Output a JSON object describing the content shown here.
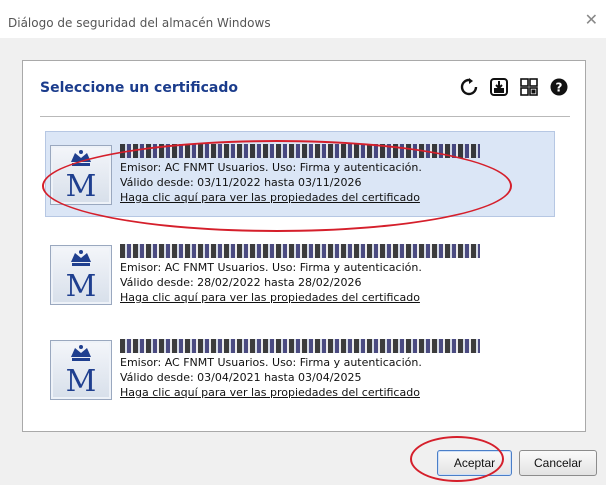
{
  "window": {
    "title": "Diálogo de seguridad del almacén Windows",
    "close_glyph": "✕"
  },
  "panel": {
    "heading": "Seleccione un certificado",
    "toolbar": [
      {
        "icon": "refresh-icon"
      },
      {
        "icon": "import-icon"
      },
      {
        "icon": "store-icon"
      },
      {
        "icon": "help-icon"
      }
    ]
  },
  "certificates": [
    {
      "selected": true,
      "emisor": "Emisor: AC FNMT Usuarios. Uso: Firma y autenticación.",
      "validez": "Válido desde: 03/11/2022 hasta 03/11/2026",
      "link": "Haga clic aquí para ver las propiedades del certificado"
    },
    {
      "selected": false,
      "emisor": "Emisor: AC FNMT Usuarios. Uso: Firma y autenticación.",
      "validez": "Válido desde: 28/02/2022 hasta 28/02/2026",
      "link": "Haga clic aquí para ver las propiedades del certificado"
    },
    {
      "selected": false,
      "emisor": "Emisor: AC FNMT Usuarios. Uso: Firma y autenticación.",
      "validez": "Válido desde: 03/04/2021 hasta 03/04/2025",
      "link": "Haga clic aquí para ver las propiedades del certificado"
    }
  ],
  "buttons": {
    "accept": "Aceptar",
    "cancel": "Cancelar"
  },
  "colors": {
    "heading": "#1b3c8c",
    "selection": "#dbe6f6",
    "annotation": "#d51f2b"
  }
}
